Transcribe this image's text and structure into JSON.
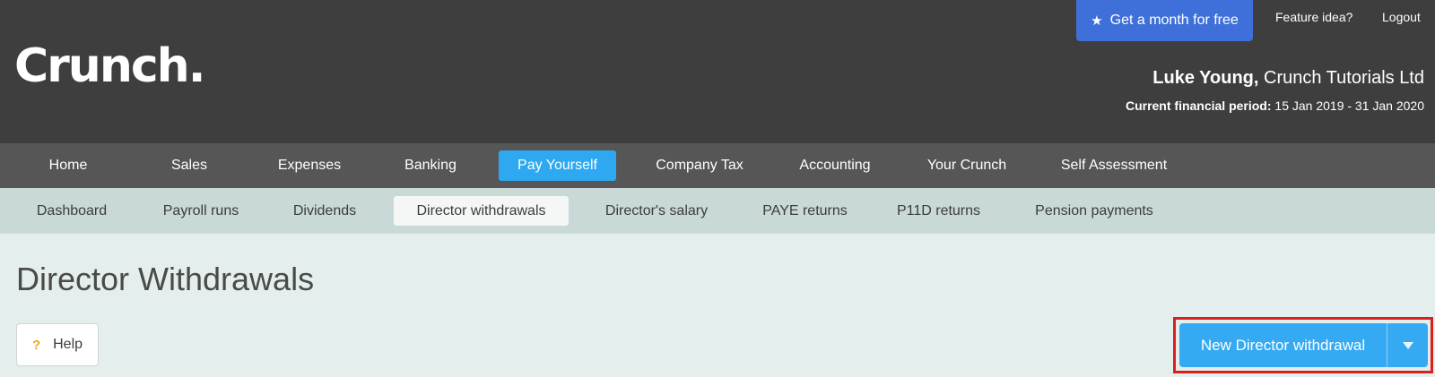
{
  "header": {
    "logo": "Crunch.",
    "promo_label": "Get a month for free",
    "feature_idea": "Feature idea?",
    "logout": "Logout",
    "user_name": "Luke Young,",
    "company": "Crunch Tutorials Ltd",
    "period_label": "Current financial period:",
    "period_value": "15 Jan 2019 - 31 Jan 2020"
  },
  "main_nav": [
    {
      "label": "Home"
    },
    {
      "label": "Sales"
    },
    {
      "label": "Expenses"
    },
    {
      "label": "Banking"
    },
    {
      "label": "Pay Yourself",
      "active": true
    },
    {
      "label": "Company Tax"
    },
    {
      "label": "Accounting"
    },
    {
      "label": "Your Crunch"
    },
    {
      "label": "Self Assessment"
    }
  ],
  "sub_nav": [
    {
      "label": "Dashboard"
    },
    {
      "label": "Payroll runs"
    },
    {
      "label": "Dividends"
    },
    {
      "label": "Director withdrawals",
      "active": true
    },
    {
      "label": "Director's salary"
    },
    {
      "label": "PAYE returns"
    },
    {
      "label": "P11D returns"
    },
    {
      "label": "Pension payments"
    }
  ],
  "page": {
    "title": "Director Withdrawals",
    "help_label": "Help",
    "help_icon": "question-mark-icon",
    "new_button_label": "New Director withdrawal"
  },
  "colors": {
    "header_bg": "#3d3e3d",
    "main_nav_bg": "#555655",
    "sub_nav_bg": "#c9d9d7",
    "content_bg": "#e4eeec",
    "accent_blue": "#2ea8f0",
    "promo_blue": "#3f70d9",
    "highlight_red": "#d9201f"
  }
}
